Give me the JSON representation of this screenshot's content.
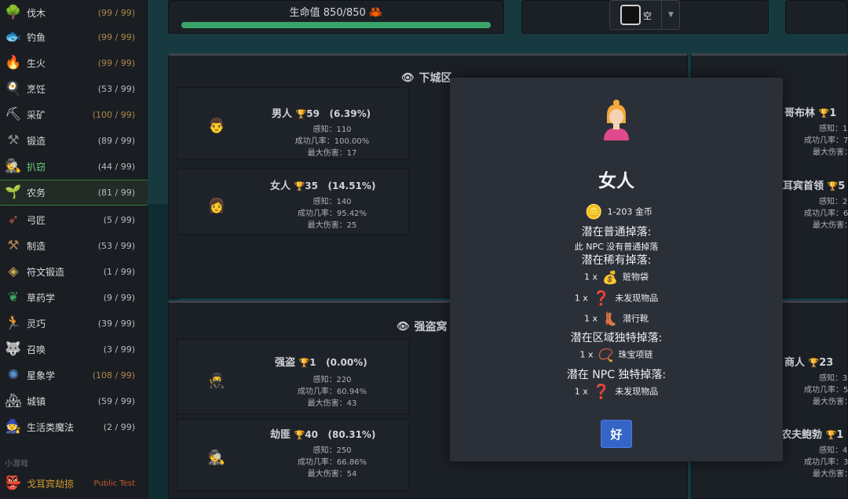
{
  "sidebar": {
    "skills": [
      {
        "name": "伐木",
        "level": "(99 / 99)",
        "icon": "tree-icon"
      },
      {
        "name": "钓鱼",
        "level": "(99 / 99)",
        "icon": "fish-icon"
      },
      {
        "name": "生火",
        "level": "(99 / 99)",
        "icon": "campfire-icon"
      },
      {
        "name": "烹饪",
        "level": "(53 / 99)",
        "icon": "chef-hat-icon"
      },
      {
        "name": "采矿",
        "level": "(100 / 99)",
        "icon": "pickaxe-icon"
      },
      {
        "name": "锻造",
        "level": "(89 / 99)",
        "icon": "anvil-icon"
      },
      {
        "name": "扒窃",
        "level": "(44 / 99)",
        "icon": "thief-icon"
      },
      {
        "name": "农务",
        "level": "(81 / 99)",
        "icon": "sprout-icon"
      },
      {
        "name": "弓匠",
        "level": "(5 / 99)",
        "icon": "bow-icon"
      },
      {
        "name": "制造",
        "level": "(53 / 99)",
        "icon": "tools-icon"
      },
      {
        "name": "符文锻造",
        "level": "(1 / 99)",
        "icon": "rune-icon"
      },
      {
        "name": "草药学",
        "level": "(9 / 99)",
        "icon": "herb-icon"
      },
      {
        "name": "灵巧",
        "level": "(39 / 99)",
        "icon": "running-icon"
      },
      {
        "name": "召唤",
        "level": "(3 / 99)",
        "icon": "wolf-icon"
      },
      {
        "name": "星象学",
        "level": "(108 / 99)",
        "icon": "astrolabe-icon"
      },
      {
        "name": "城镇",
        "level": "(59 / 99)",
        "icon": "town-icon"
      },
      {
        "name": "生活类魔法",
        "level": "(2 / 99)",
        "icon": "wizard-hat-icon"
      }
    ],
    "minigames_label": "小游戏",
    "goblin": {
      "name": "戈耳宾劫掠",
      "tag": "Public Test",
      "icon": "goblin-icon"
    }
  },
  "top": {
    "hp_label": "生命值 850/850",
    "hp_fraction": 1.0,
    "food_label": "空"
  },
  "zones": {
    "lower": {
      "title": "下城区",
      "npcs": [
        {
          "name": "男人",
          "level": "59",
          "pct": "(6.39%)",
          "perception": "感知：110",
          "success": "成功几率：100.00%",
          "maxhit": "最大伤害：17"
        },
        {
          "name": "女人",
          "level": "35",
          "pct": "(14.51%)",
          "perception": "感知：140",
          "success": "成功几率：95.42%",
          "maxhit": "最大伤害：25"
        }
      ]
    },
    "bandit": {
      "title": "强盗窝",
      "npcs": [
        {
          "name": "强盗",
          "level": "1",
          "pct": "(0.00%)",
          "perception": "感知：220",
          "success": "成功几率：60.94%",
          "maxhit": "最大伤害：43"
        },
        {
          "name": "劫匪",
          "level": "40",
          "pct": "(80.31%)",
          "perception": "感知：250",
          "success": "成功几率：66.86%",
          "maxhit": "最大伤害：54"
        }
      ]
    },
    "right_partial": [
      {
        "name": "哥布林",
        "level": "1",
        "perception": "感知：1",
        "success": "成功几率：7",
        "maxhit": "最大伤害："
      },
      {
        "name": "耳宾首领",
        "level": "5",
        "perception": "感知：2",
        "success": "成功几率：6",
        "maxhit": "最大伤害："
      },
      {
        "name": "商人",
        "level": "23",
        "perception": "感知：3",
        "success": "成功几率：5",
        "maxhit": "最大伤害："
      },
      {
        "name": "农夫鲍勃",
        "level": "1",
        "perception": "感知：4",
        "success": "成功几率：3",
        "maxhit": "最大伤害："
      }
    ]
  },
  "modal": {
    "title": "女人",
    "gold": "1-203 金币",
    "normal_header": "潜在普通掉落:",
    "normal_none": "此 NPC 没有普通掉落",
    "rare_header": "潜在稀有掉落:",
    "rare_items": [
      {
        "qty": "1 x",
        "name": "赃物袋",
        "icon": "loot-bag-icon"
      },
      {
        "qty": "1 x",
        "name": "未发现物品",
        "icon": "question-icon"
      },
      {
        "qty": "1 x",
        "name": "潜行靴",
        "icon": "boot-icon"
      }
    ],
    "zone_header": "潜在区域独特掉落:",
    "zone_items": [
      {
        "qty": "1 x",
        "name": "珠宝项链",
        "icon": "necklace-icon"
      }
    ],
    "npc_header": "潜在 NPC 独特掉落:",
    "npc_items": [
      {
        "qty": "1 x",
        "name": "未发现物品",
        "icon": "question-icon"
      }
    ],
    "ok_label": "好"
  },
  "colors": {
    "hp_fill": "#3aa56a",
    "ok_button": "#3465c7",
    "trophy": "#d7a43a",
    "active_skill": "#2f7d3a"
  }
}
